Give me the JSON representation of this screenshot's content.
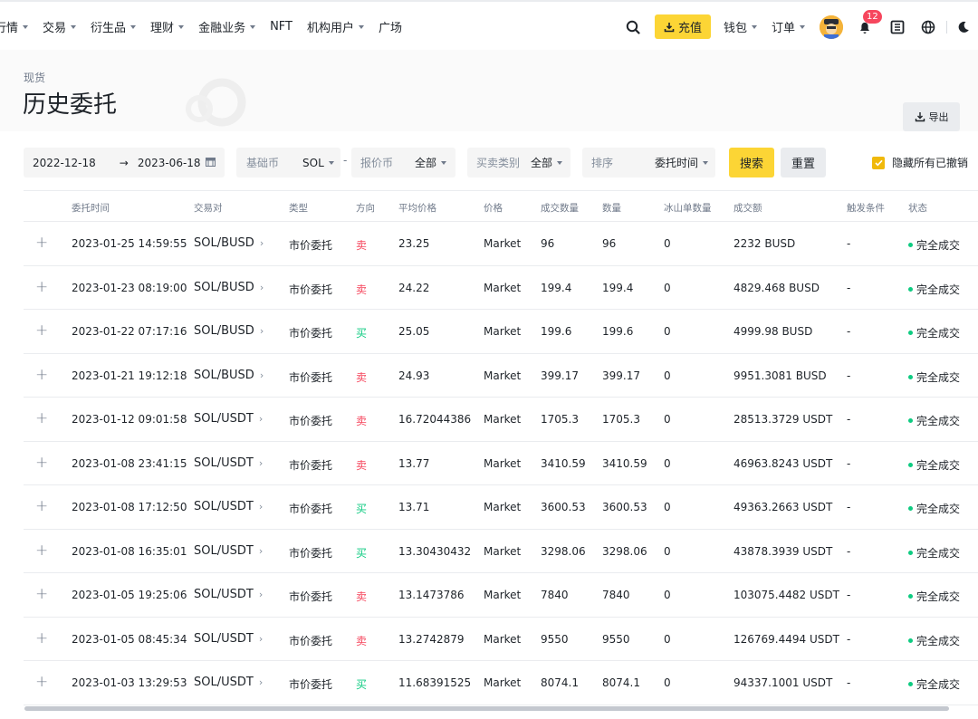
{
  "nav": {
    "items": [
      {
        "label": "行情",
        "caret": true
      },
      {
        "label": "交易",
        "caret": true
      },
      {
        "label": "衍生品",
        "caret": true
      },
      {
        "label": "理财",
        "caret": true
      },
      {
        "label": "金融业务",
        "caret": true
      },
      {
        "label": "NFT",
        "caret": false
      },
      {
        "label": "机构用户",
        "caret": true
      },
      {
        "label": "广场",
        "caret": false
      }
    ],
    "deposit_label": "充值",
    "wallet_label": "钱包",
    "orders_label": "订单",
    "notification_count": "12",
    "accent_color": "#fcd535"
  },
  "header": {
    "breadcrumb": "现货",
    "title": "历史委托",
    "export_label": "导出"
  },
  "filters": {
    "start_date": "2022-12-18",
    "arrow": "→",
    "end_date": "2023-06-18",
    "base_label": "基础币",
    "base_value": "SOL",
    "dash": "-",
    "quote_label": "报价币",
    "quote_value": "全部",
    "side_label": "买卖类别",
    "side_value": "全部",
    "sort_label": "排序",
    "sort_value": "委托时间",
    "search_label": "搜索",
    "reset_label": "重置",
    "hide_cancelled_label": "隐藏所有已撤销"
  },
  "table": {
    "headers": {
      "time": "委托时间",
      "pair": "交易对",
      "type": "类型",
      "side": "方向",
      "avg_price": "平均价格",
      "price": "价格",
      "filled": "成交数量",
      "amount": "数量",
      "iceberg": "冰山单数量",
      "total": "成交额",
      "trigger": "触发条件",
      "status": "状态"
    },
    "rows": [
      {
        "time": "2023-01-25 14:59:55",
        "pair": "SOL/BUSD",
        "type": "市价委托",
        "side": "卖",
        "side_kind": "sell",
        "avg_price": "23.25",
        "price": "Market",
        "filled": "96",
        "amount": "96",
        "iceberg": "0",
        "total": "2232 BUSD",
        "trigger": "-",
        "status": "完全成交"
      },
      {
        "time": "2023-01-23 08:19:00",
        "pair": "SOL/BUSD",
        "type": "市价委托",
        "side": "卖",
        "side_kind": "sell",
        "avg_price": "24.22",
        "price": "Market",
        "filled": "199.4",
        "amount": "199.4",
        "iceberg": "0",
        "total": "4829.468 BUSD",
        "trigger": "-",
        "status": "完全成交"
      },
      {
        "time": "2023-01-22 07:17:16",
        "pair": "SOL/BUSD",
        "type": "市价委托",
        "side": "买",
        "side_kind": "buy",
        "avg_price": "25.05",
        "price": "Market",
        "filled": "199.6",
        "amount": "199.6",
        "iceberg": "0",
        "total": "4999.98 BUSD",
        "trigger": "-",
        "status": "完全成交"
      },
      {
        "time": "2023-01-21 19:12:18",
        "pair": "SOL/BUSD",
        "type": "市价委托",
        "side": "卖",
        "side_kind": "sell",
        "avg_price": "24.93",
        "price": "Market",
        "filled": "399.17",
        "amount": "399.17",
        "iceberg": "0",
        "total": "9951.3081 BUSD",
        "trigger": "-",
        "status": "完全成交"
      },
      {
        "time": "2023-01-12 09:01:58",
        "pair": "SOL/USDT",
        "type": "市价委托",
        "side": "卖",
        "side_kind": "sell",
        "avg_price": "16.72044386",
        "price": "Market",
        "filled": "1705.3",
        "amount": "1705.3",
        "iceberg": "0",
        "total": "28513.3729 USDT",
        "trigger": "-",
        "status": "完全成交"
      },
      {
        "time": "2023-01-08 23:41:15",
        "pair": "SOL/USDT",
        "type": "市价委托",
        "side": "卖",
        "side_kind": "sell",
        "avg_price": "13.77",
        "price": "Market",
        "filled": "3410.59",
        "amount": "3410.59",
        "iceberg": "0",
        "total": "46963.8243 USDT",
        "trigger": "-",
        "status": "完全成交"
      },
      {
        "time": "2023-01-08 17:12:50",
        "pair": "SOL/USDT",
        "type": "市价委托",
        "side": "买",
        "side_kind": "buy",
        "avg_price": "13.71",
        "price": "Market",
        "filled": "3600.53",
        "amount": "3600.53",
        "iceberg": "0",
        "total": "49363.2663 USDT",
        "trigger": "-",
        "status": "完全成交"
      },
      {
        "time": "2023-01-08 16:35:01",
        "pair": "SOL/USDT",
        "type": "市价委托",
        "side": "买",
        "side_kind": "buy",
        "avg_price": "13.30430432",
        "price": "Market",
        "filled": "3298.06",
        "amount": "3298.06",
        "iceberg": "0",
        "total": "43878.3939 USDT",
        "trigger": "-",
        "status": "完全成交"
      },
      {
        "time": "2023-01-05 19:25:06",
        "pair": "SOL/USDT",
        "type": "市价委托",
        "side": "卖",
        "side_kind": "sell",
        "avg_price": "13.1473786",
        "price": "Market",
        "filled": "7840",
        "amount": "7840",
        "iceberg": "0",
        "total": "103075.4482 USDT",
        "trigger": "-",
        "status": "完全成交"
      },
      {
        "time": "2023-01-05 08:45:34",
        "pair": "SOL/USDT",
        "type": "市价委托",
        "side": "卖",
        "side_kind": "sell",
        "avg_price": "13.2742879",
        "price": "Market",
        "filled": "9550",
        "amount": "9550",
        "iceberg": "0",
        "total": "126769.4494 USDT",
        "trigger": "-",
        "status": "完全成交"
      },
      {
        "time": "2023-01-03 13:29:53",
        "pair": "SOL/USDT",
        "type": "市价委托",
        "side": "买",
        "side_kind": "buy",
        "avg_price": "11.68391525",
        "price": "Market",
        "filled": "8074.1",
        "amount": "8074.1",
        "iceberg": "0",
        "total": "94337.1001 USDT",
        "trigger": "-",
        "status": "完全成交"
      }
    ]
  },
  "colors": {
    "sell": "#f6465d",
    "buy": "#0ecb81",
    "status_dot": "#0ecb81"
  }
}
